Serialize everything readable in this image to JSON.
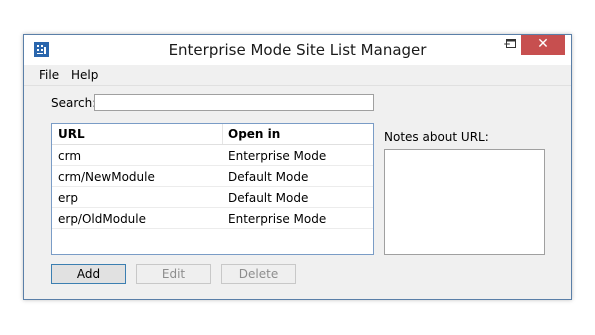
{
  "window": {
    "title": "Enterprise Mode Site List Manager",
    "minimize_glyph": "–",
    "maximize_glyph": "☐",
    "close_glyph": "✕",
    "close_color": "#c74f4f"
  },
  "menu": {
    "items": [
      {
        "label": "File"
      },
      {
        "label": "Help"
      }
    ]
  },
  "search": {
    "label": "Search:",
    "value": ""
  },
  "list": {
    "columns": [
      "URL",
      "Open in"
    ],
    "rows": [
      {
        "url": "crm",
        "open_in": "Enterprise Mode"
      },
      {
        "url": "crm/NewModule",
        "open_in": "Default Mode"
      },
      {
        "url": "erp",
        "open_in": "Default Mode"
      },
      {
        "url": "erp/OldModule",
        "open_in": "Enterprise Mode"
      }
    ]
  },
  "notes": {
    "label": "Notes about URL:",
    "value": ""
  },
  "buttons": {
    "add": "Add",
    "edit": "Edit",
    "delete": "Delete"
  },
  "icons": {
    "app": "building-icon"
  }
}
